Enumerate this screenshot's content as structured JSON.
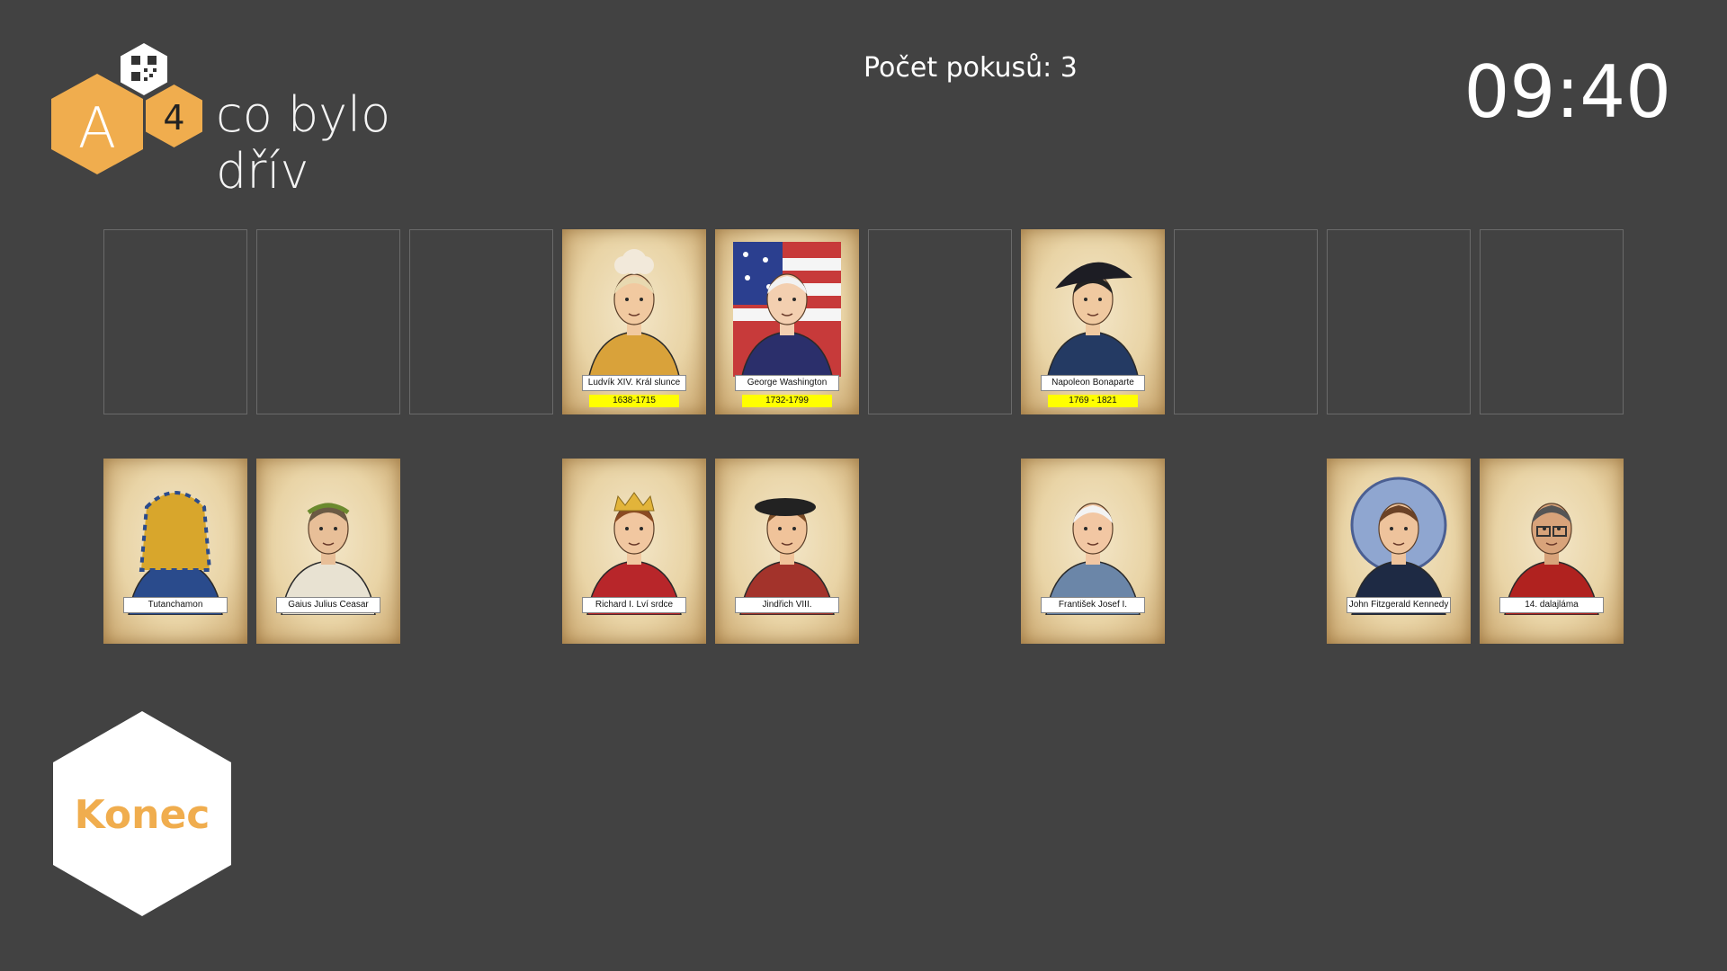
{
  "header": {
    "logo_letter": "A",
    "logo_level": "4",
    "app_title": "co bylo dřív",
    "attempts_label": "Počet pokusů: 3",
    "timer": "09:40"
  },
  "timeline_row": [
    {
      "type": "slot"
    },
    {
      "type": "slot"
    },
    {
      "type": "slot"
    },
    {
      "type": "card",
      "name": "Ludvík XIV. Král slunce",
      "years": "1638-1715",
      "icon": "louis-xiv-portrait"
    },
    {
      "type": "card",
      "name": "George Washington",
      "years": "1732-1799",
      "icon": "george-washington-portrait"
    },
    {
      "type": "slot"
    },
    {
      "type": "card",
      "name": "Napoleon Bonaparte",
      "years": "1769 - 1821",
      "icon": "napoleon-portrait"
    },
    {
      "type": "slot"
    },
    {
      "type": "slot"
    },
    {
      "type": "slot"
    }
  ],
  "hand_row": [
    {
      "type": "card",
      "name": "Tutanchamon",
      "icon": "tutankhamun-portrait"
    },
    {
      "type": "card",
      "name": "Gaius Julius Ceasar",
      "icon": "caesar-portrait"
    },
    {
      "type": "empty"
    },
    {
      "type": "card",
      "name": "Richard I. Lví srdce",
      "icon": "richard-lionheart-portrait"
    },
    {
      "type": "card",
      "name": "Jindřich VIII.",
      "icon": "henry-viii-portrait"
    },
    {
      "type": "empty"
    },
    {
      "type": "card",
      "name": "František Josef I.",
      "icon": "franz-joseph-portrait"
    },
    {
      "type": "empty"
    },
    {
      "type": "card",
      "name": "John Fitzgerald Kennedy",
      "icon": "jfk-portrait"
    },
    {
      "type": "card",
      "name": "14. dalajláma",
      "icon": "dalai-lama-portrait"
    }
  ],
  "end_button": {
    "label": "Konec"
  },
  "colors": {
    "background": "#424242",
    "accent": "#f0ad4e",
    "year_highlight": "#ffff00"
  }
}
